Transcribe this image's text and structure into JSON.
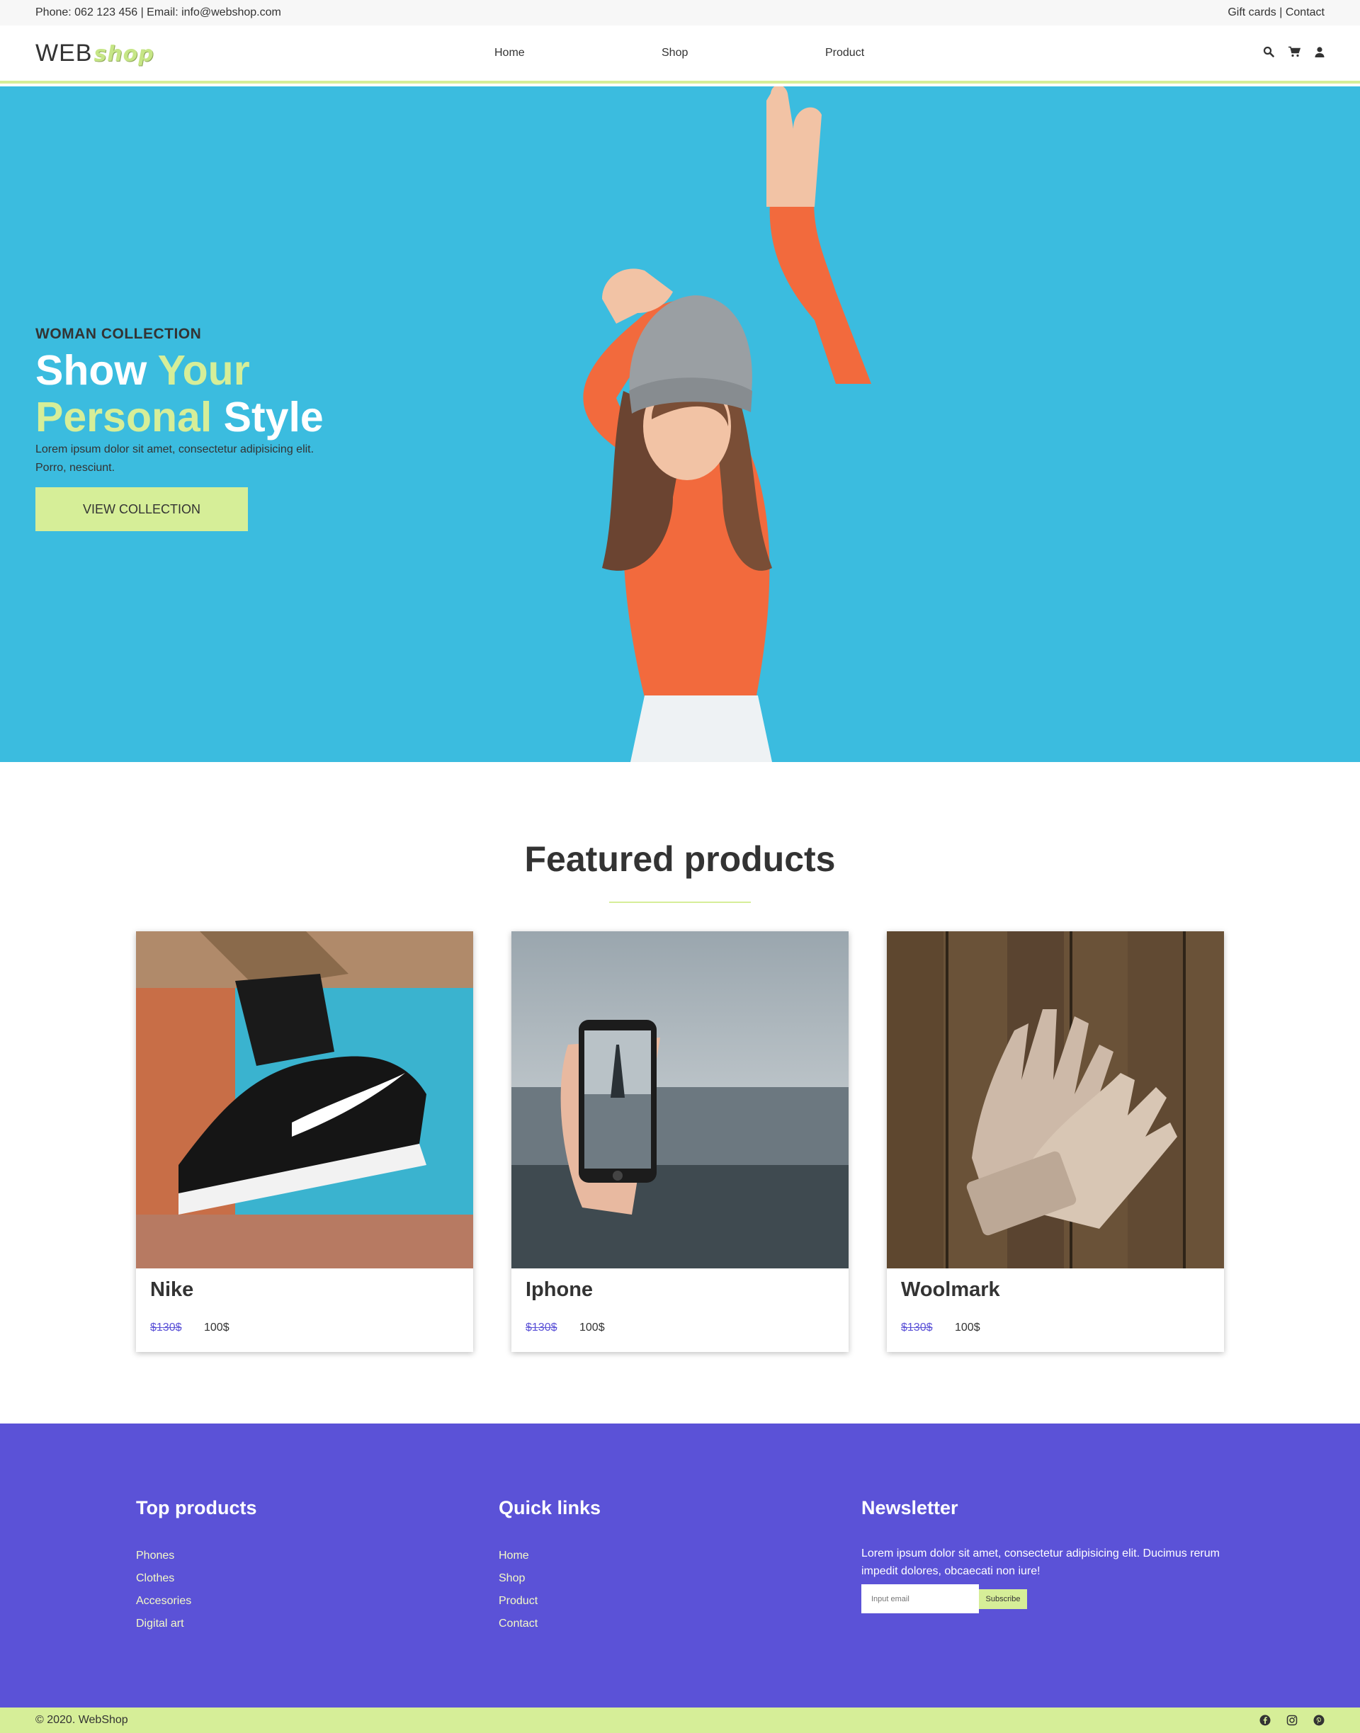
{
  "topbar": {
    "contact_info": "Phone: 062 123 456  |  Email: info@webshop.com",
    "links": "Gift cards | Contact"
  },
  "header": {
    "logo_web": "WEB",
    "logo_shop": "shop",
    "nav": [
      "Home",
      "Shop",
      "Product"
    ],
    "icons": [
      "search-icon",
      "cart-icon",
      "user-icon"
    ]
  },
  "hero": {
    "eyebrow": "WOMAN COLLECTION",
    "headline_1": "Show ",
    "headline_2": "Your",
    "headline_3": "Personal",
    "headline_4": " Style",
    "description": "Lorem ipsum dolor sit amet, consectetur adipisicing elit. Porro, nesciunt.",
    "button": "VIEW COLLECTION"
  },
  "featured": {
    "title": "Featured products",
    "products": [
      {
        "name": "Nike",
        "old_price": "$130$",
        "price": "100$"
      },
      {
        "name": "Iphone",
        "old_price": "$130$",
        "price": "100$"
      },
      {
        "name": "Woolmark",
        "old_price": "$130$",
        "price": "100$"
      }
    ]
  },
  "footer": {
    "top_products": {
      "title": "Top products",
      "items": [
        "Phones",
        "Clothes",
        "Accesories",
        "Digital art"
      ]
    },
    "quick_links": {
      "title": "Quick links",
      "items": [
        "Home",
        "Shop",
        "Product",
        "Contact"
      ]
    },
    "newsletter": {
      "title": "Newsletter",
      "text": "Lorem ipsum dolor sit amet, consectetur adipisicing elit. Ducimus rerum impedit dolores, obcaecati non iure!",
      "placeholder": "Input email",
      "button": "Subscribe"
    },
    "copyright": "© 2020. WebShop",
    "social": [
      "facebook-icon",
      "instagram-icon",
      "pinterest-icon"
    ]
  },
  "colors": {
    "accent_green": "#d6ee98",
    "hero_blue": "#3bbcdf",
    "footer_purple": "#5b52d7"
  }
}
